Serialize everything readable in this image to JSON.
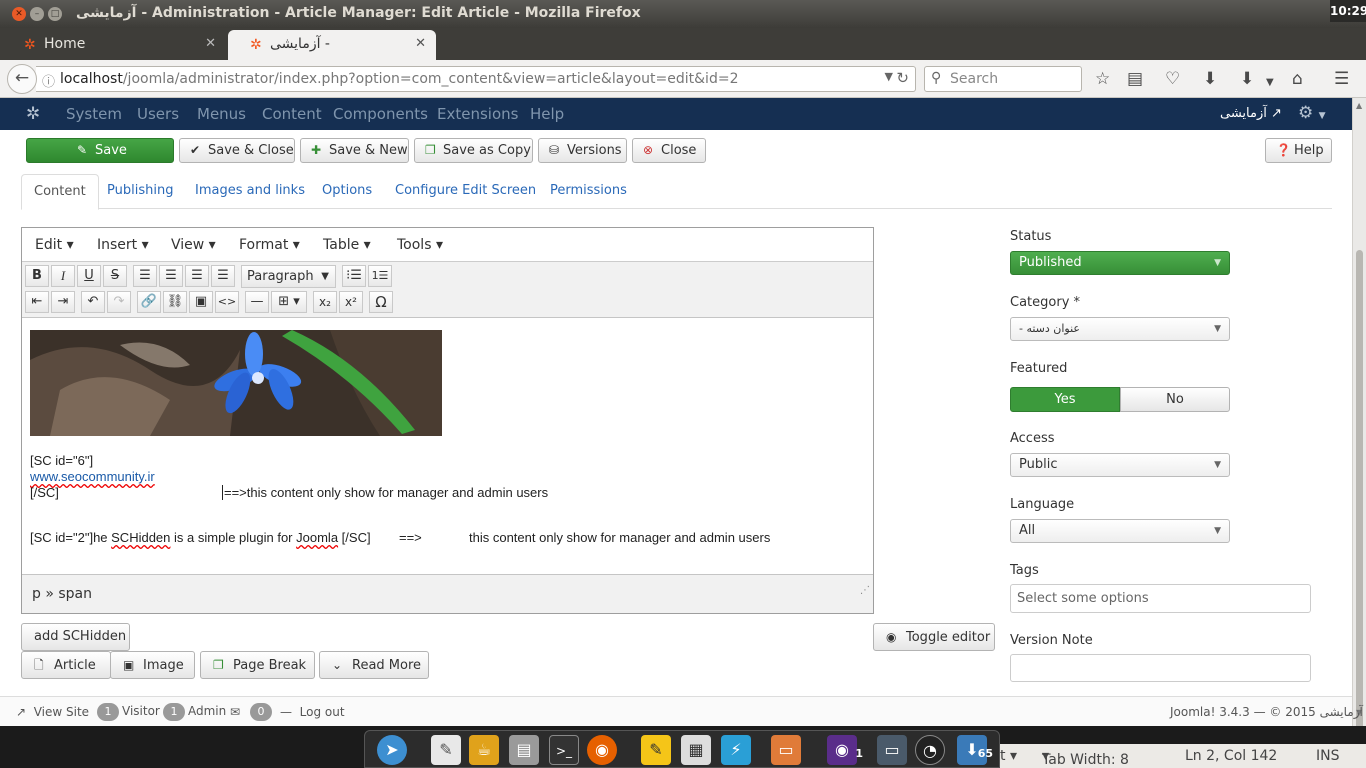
{
  "window": {
    "title": "آزمایشی - Administration - Article Manager: Edit Article - Mozilla Firefox",
    "clock": "10:29"
  },
  "browser_tabs": [
    {
      "label": "Home"
    },
    {
      "label": "آزمایشی - Administ..."
    }
  ],
  "address": {
    "host": "localhost",
    "path": "/joomla/administrator/index.php?option=com_content&view=article&layout=edit&id=2",
    "search_placeholder": "Search"
  },
  "joomla_menu": [
    "System",
    "Users",
    "Menus",
    "Content",
    "Components",
    "Extensions",
    "Help"
  ],
  "site_name": "آزمایشی",
  "toolbar": {
    "save": "Save",
    "save_close": "Save & Close",
    "save_new": "Save & New",
    "save_copy": "Save as Copy",
    "versions": "Versions",
    "close": "Close",
    "help": "Help"
  },
  "tabs": [
    "Content",
    "Publishing",
    "Images and links",
    "Options",
    "Configure Edit Screen",
    "Permissions"
  ],
  "editor": {
    "menus": [
      "Edit",
      "Insert",
      "View",
      "Format",
      "Table",
      "Tools"
    ],
    "format_select": "Paragraph",
    "lines": {
      "sc_open": "[SC id=\"6\"]",
      "link": "www.seocommunity.ir",
      "sc_close": "[/SC]",
      "arrow_text": "==>this content only show for manager and admin users",
      "sc2_a": "[SC id=\"2\"]he ",
      "sc2_word": "SCHidden",
      "sc2_b": " is a simple plugin for ",
      "sc2_joomla": "Joomla",
      "sc2_c": " [/SC]",
      "sc2_arrow": "==>",
      "sc2_text": "this content only show for manager and admin users"
    },
    "path": "p » span"
  },
  "editor_buttons": {
    "add_schidden": "add SCHidden",
    "toggle_editor": "Toggle editor",
    "article": "Article",
    "image": "Image",
    "page_break": "Page Break",
    "read_more": "Read More"
  },
  "sidebar": {
    "status_label": "Status",
    "status_value": "Published",
    "category_label": "Category *",
    "category_value": "- عنوان دسته",
    "featured_label": "Featured",
    "featured_yes": "Yes",
    "featured_no": "No",
    "access_label": "Access",
    "access_value": "Public",
    "language_label": "Language",
    "language_value": "All",
    "tags_label": "Tags",
    "tags_placeholder": "Select some options",
    "version_note_label": "Version Note"
  },
  "footer": {
    "view_site": "View Site",
    "visitor_count": "1",
    "visitor_label": "Visitor",
    "admin_count": "1",
    "admin_label": "Admin",
    "msg_count": "0",
    "logout": "Log out",
    "copyright": "Joomla! 3.4.3 — © 2015 آزمایشی"
  },
  "gedit_status": {
    "tab_width": "Tab Width: 8",
    "position": "Ln 2, Col 142",
    "mode": "INS"
  },
  "dock": {
    "firefox_count": "1",
    "updates_count": "65"
  },
  "colors": {
    "joomla_header": "#152f52",
    "save_green": "#3c9a3c",
    "link_blue": "#2a69b8"
  }
}
